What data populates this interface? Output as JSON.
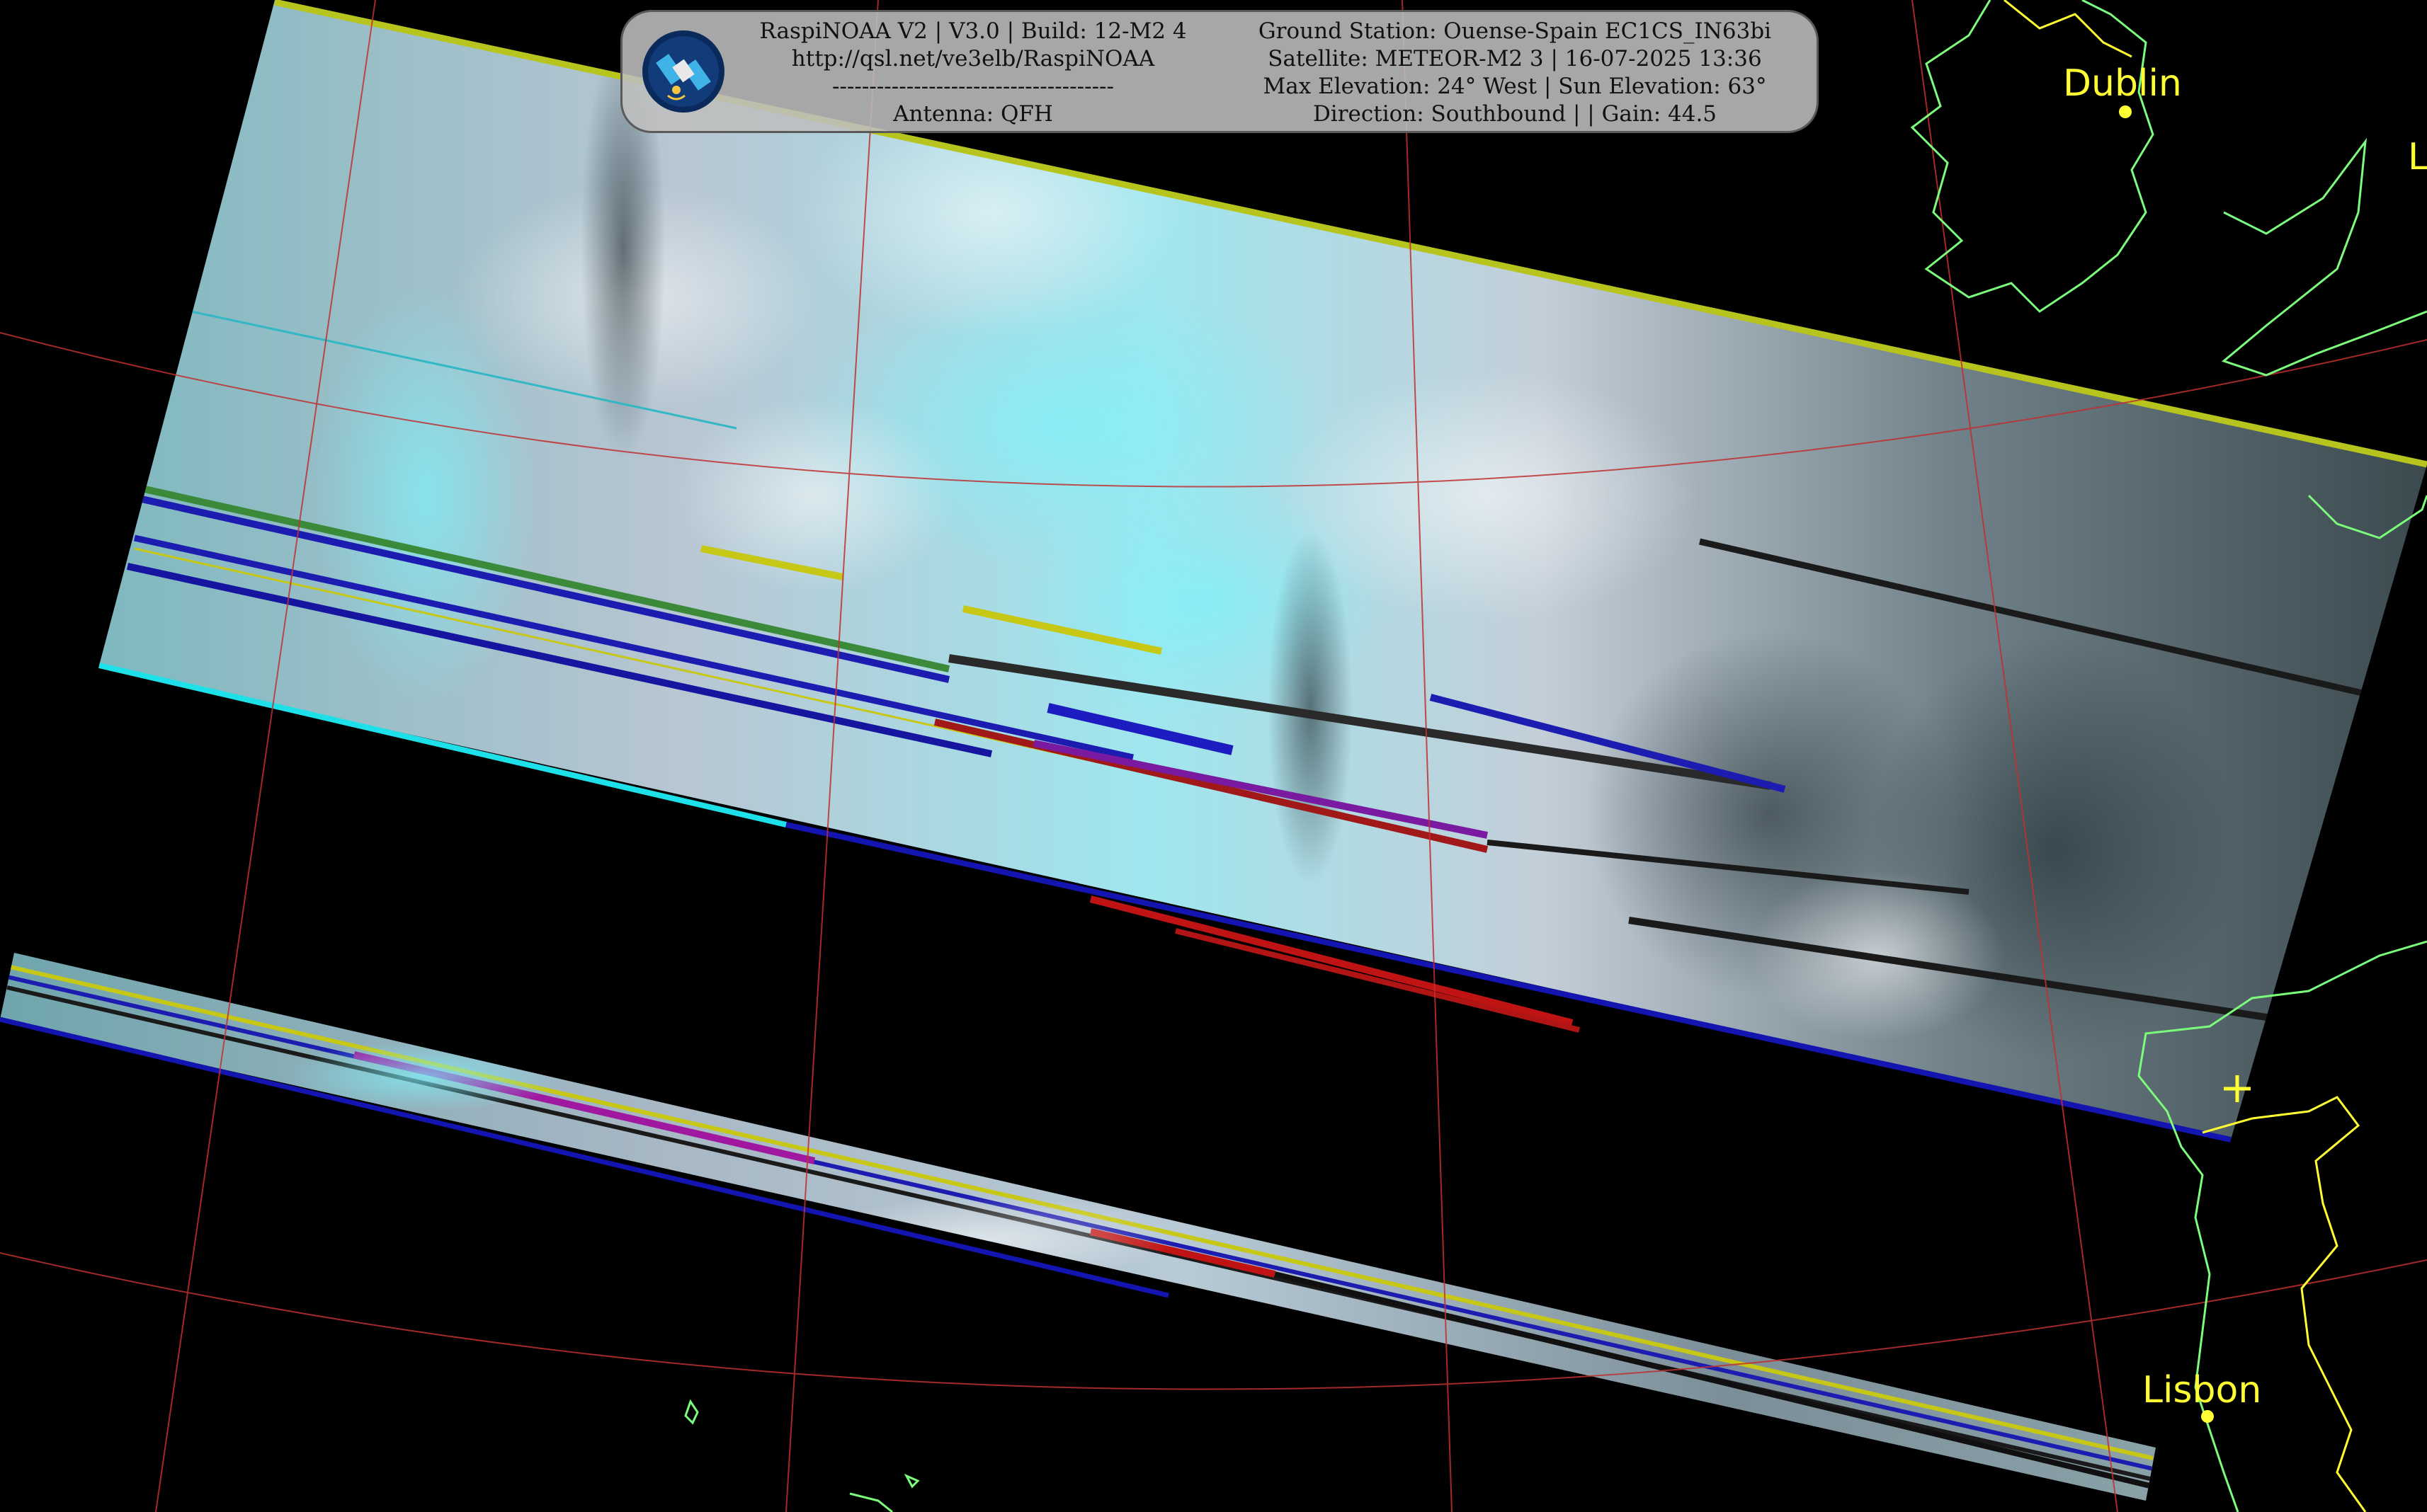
{
  "header": {
    "left_lines": [
      "RaspiNOAA V2 | V3.0 | Build: 12-M2 4",
      "http://qsl.net/ve3elb/RaspiNOAA",
      "--------------------------------------",
      "Antenna: QFH"
    ],
    "right_lines": [
      "Ground Station: Ouense-Spain EC1CS_IN63bi",
      "Satellite: METEOR-M2 3 | 16-07-2025 13:36",
      "Max Elevation: 24° West | Sun Elevation: 63°",
      "Direction: Southbound | | Gain: 44.5"
    ],
    "logo_icon": "satellite-icon"
  },
  "map_labels": {
    "cities": [
      "Dublin",
      "Lisbon"
    ],
    "edge_letter": "L",
    "station_marker": "+"
  },
  "colors": {
    "background": "#000000",
    "coastline": "#7CFC7C",
    "borders": "#ffff33",
    "graticule": "#c03030",
    "label": "#ffff33",
    "cloud_cyan": "#7fe8f0",
    "ocean_dark": "#2f3e44"
  }
}
